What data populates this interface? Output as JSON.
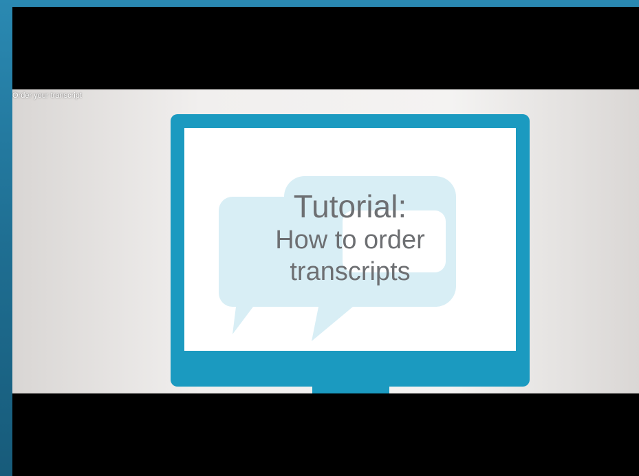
{
  "video": {
    "title": "Order your transcript"
  },
  "slide": {
    "line1": "Tutorial:",
    "line2": "How to order",
    "line3": "transcripts"
  },
  "colors": {
    "background": "#1f6f93",
    "monitor": "#1b9ac0",
    "bubble": "#d8eef5",
    "text": "#6d6f72"
  },
  "icons": [
    "speech-bubbles-icon"
  ]
}
